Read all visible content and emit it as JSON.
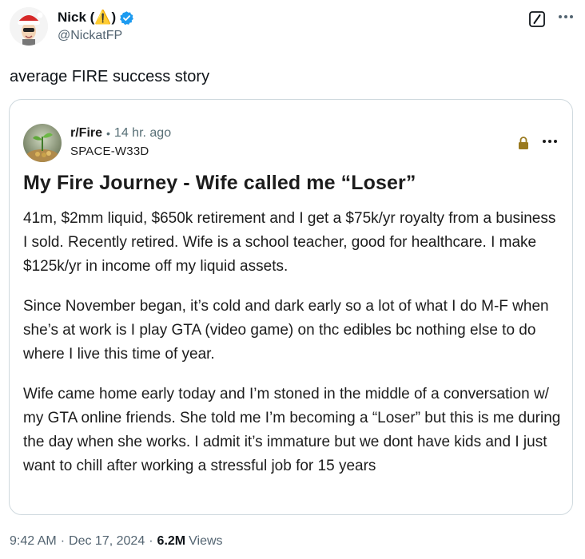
{
  "tweet": {
    "author_name": "Nick (⚠️)",
    "author_handle": "@NickatFP",
    "text": "average FIRE success story",
    "time": "9:42 AM",
    "date": "Dec 17, 2024",
    "views_count": "6.2M",
    "views_label": "Views"
  },
  "embed": {
    "subreddit": "r/Fire",
    "separator": "•",
    "age": "14 hr. ago",
    "username": "SPACE-W33D",
    "title": "My Fire Journey - Wife called me “Loser”",
    "paragraphs": [
      "41m, $2mm liquid, $650k retirement and I get a $75k/yr royalty from a business I sold. Recently retired. Wife is a school teacher, good for healthcare. I make $125k/yr in income off my liquid assets.",
      "Since November began, it’s cold and dark early so a lot of what I do M-F when she’s at work is I play GTA (video game) on thc edibles bc nothing else to do where I live this time of year.",
      "Wife came home early today and I’m stoned in the middle of a conversation w/ my GTA online friends. She told me I’m becoming a “Loser” but this is me during the day when she works. I admit it’s immature but we dont have kids and I just want to chill after working a stressful job for 15 years"
    ]
  },
  "icons": {
    "verified": "verified-badge-icon",
    "grok": "grok-icon",
    "more": "more-icon",
    "lock": "lock-icon"
  },
  "colors": {
    "text": "#0f1419",
    "secondary": "#536471",
    "border": "#cfd9de",
    "verified": "#1d9bf0",
    "lock": "#9a7a1f"
  }
}
